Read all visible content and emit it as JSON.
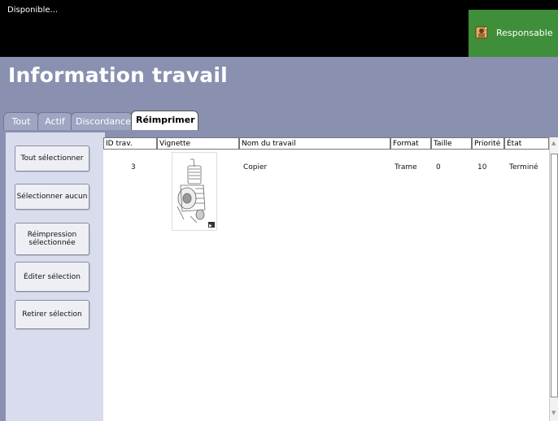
{
  "status_bar": {
    "status_text": "Disponible..."
  },
  "user_button": {
    "label": "Responsable",
    "icon": "user-key-icon",
    "color": "#3f8f3a"
  },
  "header": {
    "title": "Information travail"
  },
  "tabs": [
    {
      "label": "Tout",
      "active": false
    },
    {
      "label": "Actif",
      "active": false
    },
    {
      "label": "Discordance",
      "active": false
    },
    {
      "label": "Réimprimer",
      "active": true
    }
  ],
  "actions": [
    {
      "label": "Tout sélectionner"
    },
    {
      "label": "Sélectionner aucun"
    },
    {
      "label": "Réimpression sélectionnée"
    },
    {
      "label": "Éditer sélection"
    },
    {
      "label": "Retirer sélection"
    }
  ],
  "table": {
    "columns": [
      "ID trav.",
      "Vignette",
      "Nom du travail",
      "Format",
      "Taille",
      "Priorité",
      "État"
    ],
    "rows": [
      {
        "id": "3",
        "thumbnail": "vehicle-sketch-thumbnail",
        "name": "Copier",
        "format": "Trame",
        "size": "0",
        "priority": "10",
        "state": "Terminé"
      }
    ]
  },
  "colors": {
    "header_bg": "#8a90b0",
    "panel_bg": "#d9dced",
    "topbar_bg": "#000000"
  }
}
